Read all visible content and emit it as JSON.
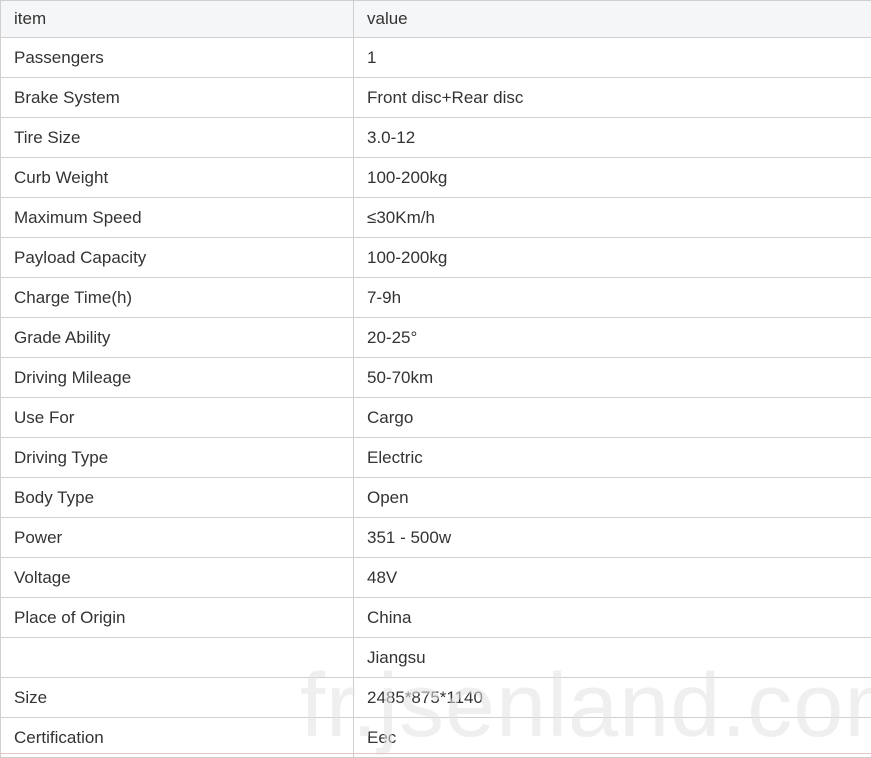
{
  "table": {
    "header": {
      "item": "item",
      "value": "value"
    },
    "rows": [
      {
        "item": "Passengers",
        "value": "1"
      },
      {
        "item": "Brake System",
        "value": "Front disc+Rear disc"
      },
      {
        "item": "Tire Size",
        "value": "3.0-12"
      },
      {
        "item": "Curb Weight",
        "value": "100-200kg"
      },
      {
        "item": "Maximum Speed",
        "value": "≤30Km/h"
      },
      {
        "item": "Payload Capacity",
        "value": "100-200kg"
      },
      {
        "item": "Charge Time(h)",
        "value": "7-9h"
      },
      {
        "item": "Grade Ability",
        "value": "20-25°"
      },
      {
        "item": "Driving Mileage",
        "value": "50-70km"
      },
      {
        "item": "Use For",
        "value": "Cargo"
      },
      {
        "item": "Driving Type",
        "value": "Electric"
      },
      {
        "item": "Body Type",
        "value": "Open"
      },
      {
        "item": "Power",
        "value": "351 - 500w"
      },
      {
        "item": "Voltage",
        "value": "48V"
      },
      {
        "item": "Place of Origin",
        "value": "China"
      },
      {
        "item": "",
        "value": "Jiangsu"
      },
      {
        "item": "Size",
        "value": "2485*875*1140"
      },
      {
        "item": "Certification",
        "value": "Eec"
      }
    ]
  },
  "watermark": "fr.jsenland.com"
}
